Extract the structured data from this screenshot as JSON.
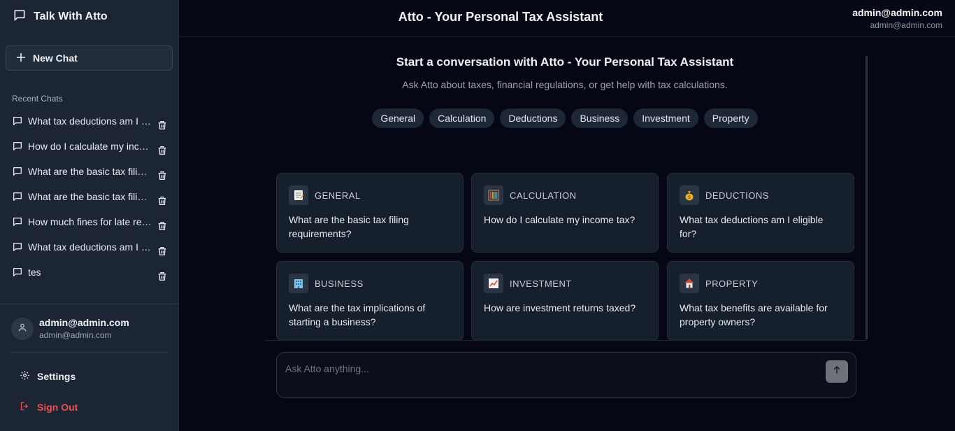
{
  "sidebar": {
    "brand": "Talk With Atto",
    "new_chat_label": "New Chat",
    "recent_title": "Recent Chats",
    "chats": [
      {
        "label": "What tax deductions am I eligible for?"
      },
      {
        "label": "How do I calculate my income tax?"
      },
      {
        "label": "What are the basic tax filing requirements?"
      },
      {
        "label": "What are the basic tax filing requirements?"
      },
      {
        "label": "How much fines for late returns?"
      },
      {
        "label": "What tax deductions am I eligible for?"
      },
      {
        "label": "tes"
      }
    ],
    "user": {
      "name": "admin@admin.com",
      "email": "admin@admin.com"
    },
    "settings_label": "Settings",
    "signout_label": "Sign Out"
  },
  "header": {
    "title": "Atto - Your Personal Tax Assistant",
    "user_name": "admin@admin.com",
    "user_email": "admin@admin.com"
  },
  "main": {
    "welcome_title": "Start a conversation with Atto - Your Personal Tax Assistant",
    "welcome_subtitle": "Ask Atto about taxes, financial regulations, or get help with tax calculations.",
    "filters": [
      "General",
      "Calculation",
      "Deductions",
      "Business",
      "Investment",
      "Property"
    ],
    "cards": [
      {
        "category": "GENERAL",
        "icon": "memo-icon",
        "question": "What are the basic tax filing requirements?"
      },
      {
        "category": "CALCULATION",
        "icon": "abacus-icon",
        "question": "How do I calculate my income tax?"
      },
      {
        "category": "DEDUCTIONS",
        "icon": "money-bag-icon",
        "question": "What tax deductions am I eligible for?"
      },
      {
        "category": "BUSINESS",
        "icon": "office-building-icon",
        "question": "What are the tax implications of starting a business?"
      },
      {
        "category": "INVESTMENT",
        "icon": "chart-increasing-icon",
        "question": "How are investment returns taxed?"
      },
      {
        "category": "PROPERTY",
        "icon": "house-icon",
        "question": "What tax benefits are available for property owners?"
      }
    ],
    "input": {
      "placeholder": "Ask Atto anything..."
    }
  },
  "colors": {
    "danger": "#ef4f4f",
    "sidebar_bg": "#1b2533",
    "card_bg": "#161f2c"
  }
}
